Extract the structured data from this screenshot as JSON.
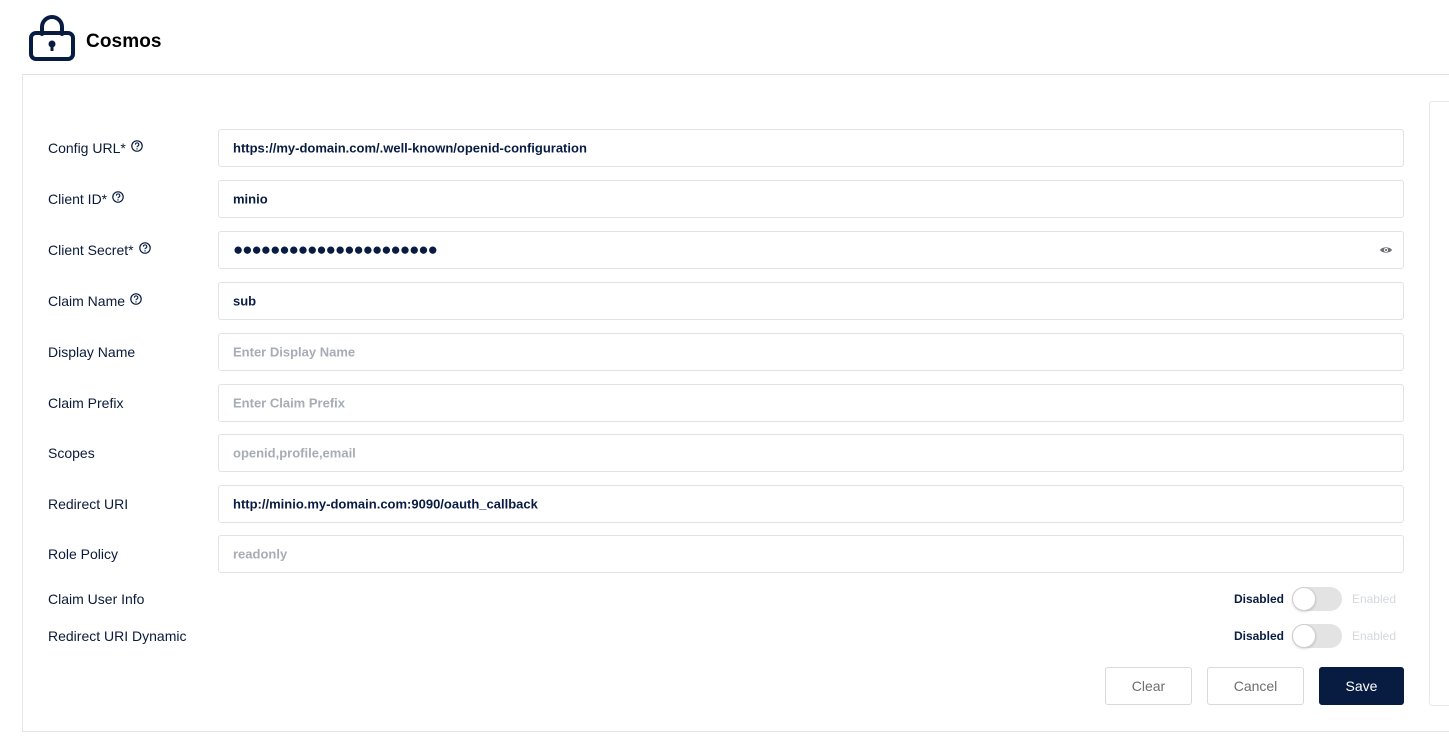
{
  "app": {
    "title": "Cosmos",
    "logo_icon": "lock-icon"
  },
  "colors": {
    "primary": "#081c42",
    "border": "#e3e3e3",
    "placeholder": "#a7acb5"
  },
  "form": {
    "fields": [
      {
        "label": "Config URL*",
        "help": true,
        "value": "https://my-domain.com/.well-known/openid-configuration",
        "placeholder": ""
      },
      {
        "label": "Client ID*",
        "help": true,
        "value": "minio",
        "placeholder": ""
      },
      {
        "label": "Client Secret*",
        "help": true,
        "value": "●●●●●●●●●●●●●●●●●●●●●●",
        "placeholder": "",
        "masked": true
      },
      {
        "label": "Claim Name",
        "help": true,
        "value": "sub",
        "placeholder": ""
      },
      {
        "label": "Display Name",
        "help": false,
        "value": "",
        "placeholder": "Enter Display Name"
      },
      {
        "label": "Claim Prefix",
        "help": false,
        "value": "",
        "placeholder": "Enter Claim Prefix"
      },
      {
        "label": "Scopes",
        "help": false,
        "value": "",
        "placeholder": "openid,profile,email"
      },
      {
        "label": "Redirect URI",
        "help": false,
        "value": "http://minio.my-domain.com:9090/oauth_callback",
        "placeholder": ""
      },
      {
        "label": "Role Policy",
        "help": false,
        "value": "",
        "placeholder": "readonly"
      }
    ],
    "toggles": [
      {
        "label": "Claim User Info",
        "off_label": "Disabled",
        "on_label": "Enabled",
        "enabled": false
      },
      {
        "label": "Redirect URI Dynamic",
        "off_label": "Disabled",
        "on_label": "Enabled",
        "enabled": false
      }
    ]
  },
  "actions": {
    "clear": "Clear",
    "cancel": "Cancel",
    "save": "Save"
  }
}
